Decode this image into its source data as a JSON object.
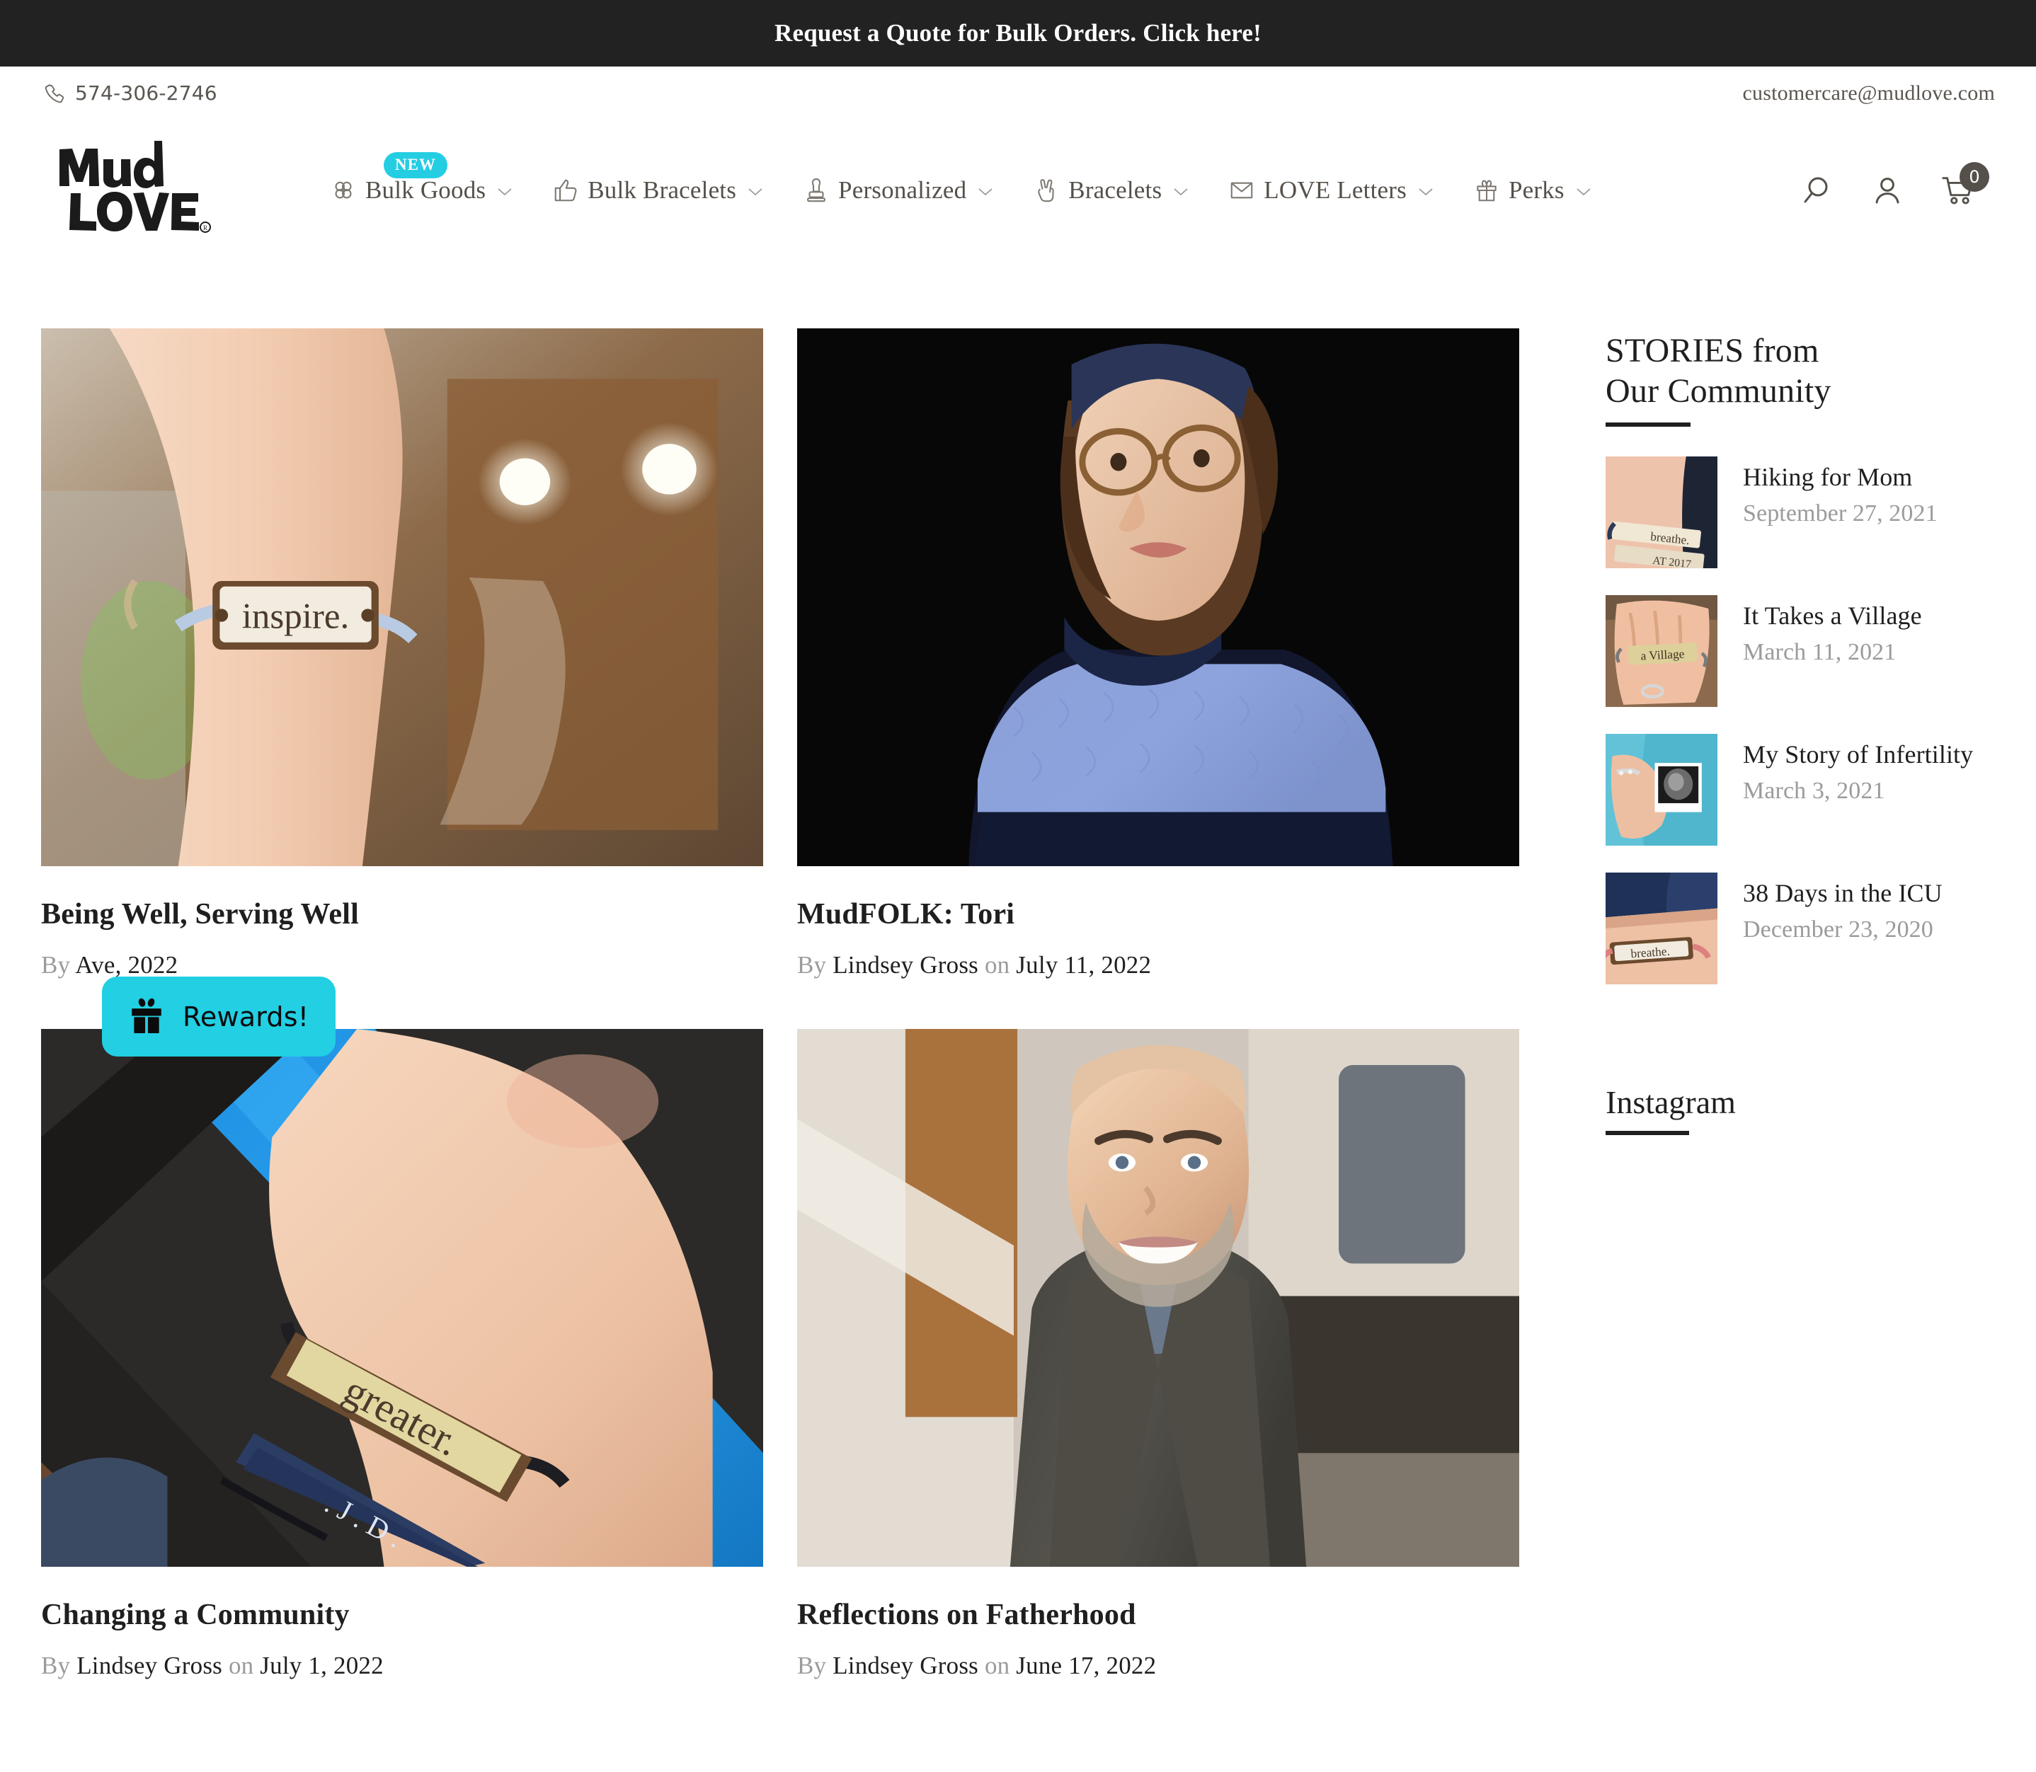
{
  "announcement": {
    "text": "Request a Quote for Bulk Orders. Click here!"
  },
  "utility": {
    "phone": "574-306-2746",
    "email": "customercare@mudlove.com",
    "phone_icon": "phone-icon"
  },
  "brand": {
    "logo_line1": "Mud",
    "logo_line2": "LOVE",
    "logo_mark": "registered-trademark"
  },
  "nav": {
    "items": [
      {
        "label": "Bulk Goods",
        "icon": "flower-icon",
        "caret": "⌄",
        "badge": "NEW"
      },
      {
        "label": "Bulk Bracelets",
        "icon": "thumbs-up-icon",
        "caret": "⌄",
        "badge": ""
      },
      {
        "label": "Personalized",
        "icon": "stamp-icon",
        "caret": "⌄",
        "badge": ""
      },
      {
        "label": "Bracelets",
        "icon": "peace-hand-icon",
        "caret": "⌄",
        "badge": ""
      },
      {
        "label": "LOVE Letters",
        "icon": "envelope-icon",
        "caret": "⌄",
        "badge": ""
      },
      {
        "label": "Perks",
        "icon": "gift-icon",
        "caret": "⌄",
        "badge": ""
      }
    ]
  },
  "header_icons": {
    "search": "search-icon",
    "account": "account-icon",
    "cart": "cart-icon",
    "cart_count": "0"
  },
  "articles": [
    {
      "title": "Being Well, Serving Well",
      "by_label": "By",
      "author": "Ave",
      "on_label": "",
      "date": ", 2022",
      "image_alt": "wrist-with-inspire-bracelet"
    },
    {
      "title": "MudFOLK: Tori",
      "by_label": "By",
      "author": "Lindsey Gross",
      "on_label": "on",
      "date": "July 11, 2022",
      "image_alt": "portrait-woman-glasses-blue-sweater"
    },
    {
      "title": "Changing a Community",
      "by_label": "By",
      "author": "Lindsey Gross",
      "on_label": "on",
      "date": "July 1, 2022",
      "image_alt": "wrist-with-greater-bracelet"
    },
    {
      "title": "Reflections on Fatherhood",
      "by_label": "By",
      "author": "Lindsey Gross",
      "on_label": "on",
      "date": "June 17, 2022",
      "image_alt": "portrait-smiling-bald-man"
    }
  ],
  "sidebar": {
    "stories_heading_line1": "STORIES from",
    "stories_heading_line2": "Our Community",
    "stories": [
      {
        "title": "Hiking for Mom",
        "date": "September 27, 2021",
        "image_alt": "wrist-breathe-bracelet-at-2017"
      },
      {
        "title": "It Takes a Village",
        "date": "March 11, 2021",
        "image_alt": "hand-holding-a-village-bracelet"
      },
      {
        "title": "My Story of Infertility",
        "date": "March 3, 2021",
        "image_alt": "hand-holding-ultrasound-photo"
      },
      {
        "title": "38 Days in the ICU",
        "date": "December 23, 2020",
        "image_alt": "wrist-breathe-bracelet-pink-cord"
      }
    ],
    "instagram_heading": "Instagram"
  },
  "rewards_widget": {
    "label": "Rewards!",
    "icon": "gift-icon",
    "color": "#22CFE3"
  },
  "colors": {
    "announcement_bg": "#222222",
    "accent_cyan": "#22CFE3",
    "text_dark": "#1f1f1f",
    "text_muted": "#9b9b9b",
    "icon_gray": "#55504a"
  }
}
